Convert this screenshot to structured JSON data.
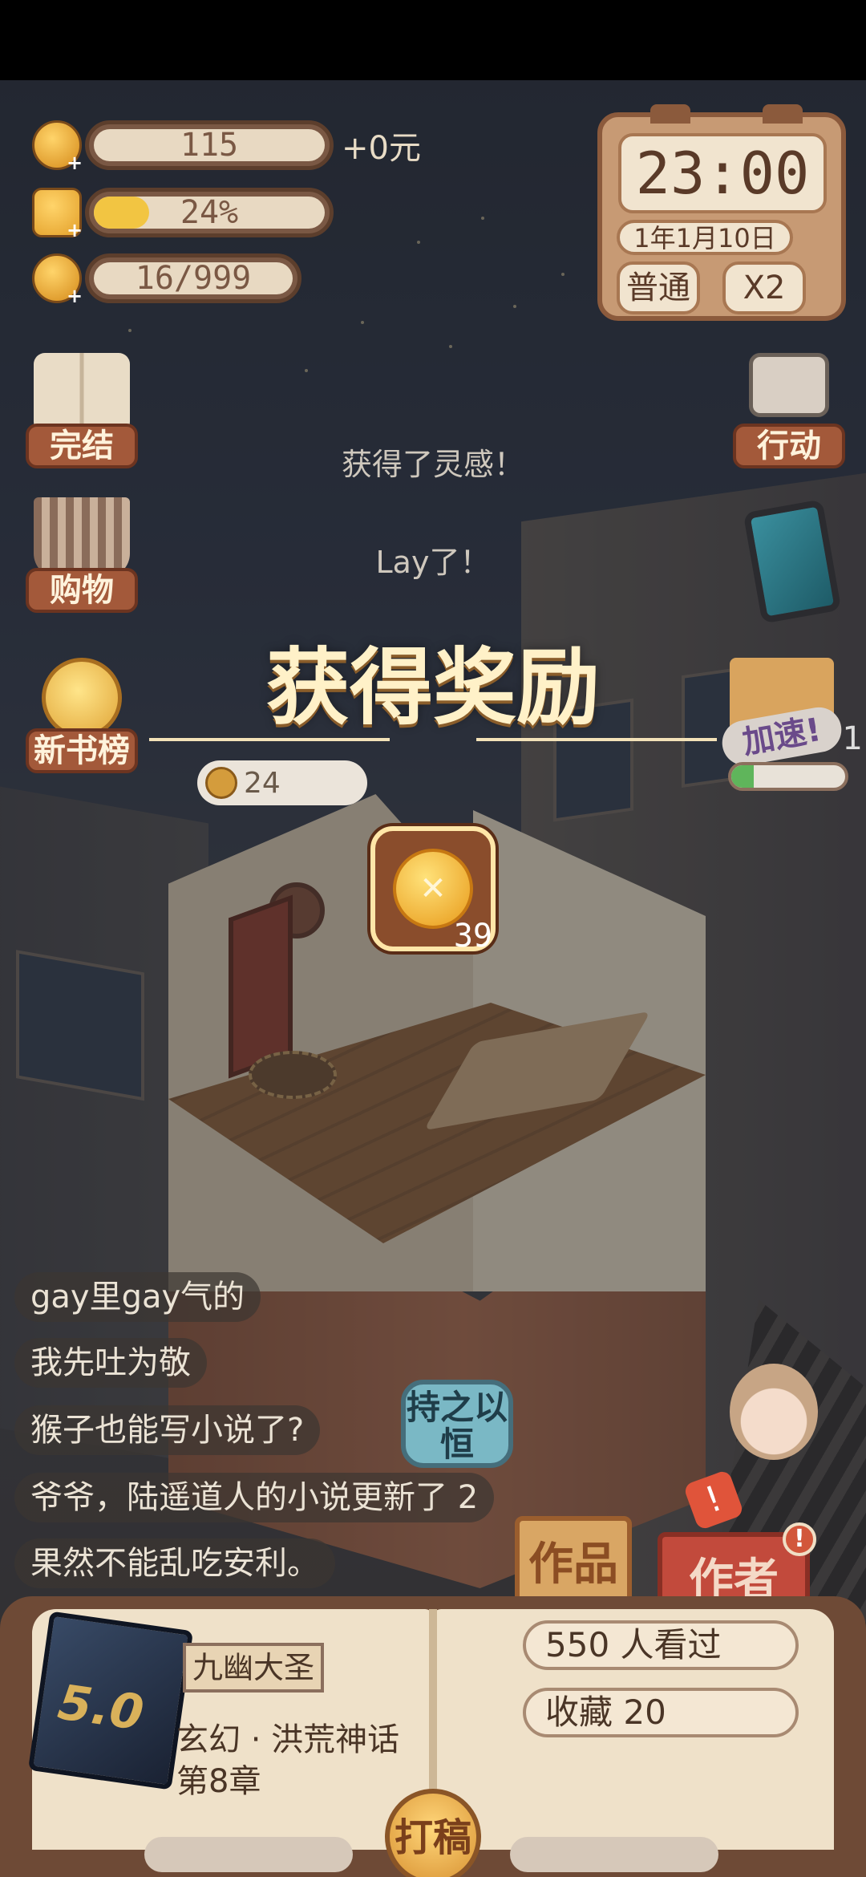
{
  "hud": {
    "coins": {
      "value": "115",
      "bonus": "+0元"
    },
    "energy": {
      "value": "24%",
      "fill_percent": 24
    },
    "inspiration": {
      "value": "16/999"
    }
  },
  "clock": {
    "time": "23:00",
    "date": "1年1月10日",
    "mode": "普通",
    "speed": "X2"
  },
  "left_menu": [
    {
      "label": "完结",
      "icon": "open-book-icon"
    },
    {
      "label": "购物",
      "icon": "shopping-basket-icon"
    },
    {
      "label": "新书榜",
      "icon": "medal-icon"
    }
  ],
  "right_menu": [
    {
      "label": "行动",
      "icon": "typewriter-icon"
    },
    {
      "icon": "tablet-icon"
    }
  ],
  "float_messages": [
    "获得了灵感！",
    "Lay了！"
  ],
  "reward": {
    "title": "获得奖励",
    "item_icon": "coin-icon",
    "quantity": "39"
  },
  "room_coin_bubble": "24",
  "speedup": {
    "label": "加速!",
    "count": "1",
    "progress_percent": 20
  },
  "chat_comments": [
    "gay里gay气的",
    "我先吐为敬",
    "猴子也能写小说了?",
    "爷爷，陆遥道人的小说更新了 2",
    "果然不能乱吃安利。"
  ],
  "persist_badge": "持之以恒",
  "tabs": {
    "works": "作品",
    "author": "作者",
    "author_badge": "!"
  },
  "novel": {
    "rating": "5.0",
    "title": "九幽大圣",
    "genre": "玄幻 · 洪荒神话",
    "chapter": "第8章",
    "views": "550    人看过",
    "favorites": "收藏 20"
  },
  "write_button": "打稿",
  "colors": {
    "accent_gold": "#f2c542",
    "menu_brown": "#a3593a",
    "reward_title": "#fff1c8",
    "author_tab": "#c24a3c",
    "progress_green": "#5fb55b"
  }
}
